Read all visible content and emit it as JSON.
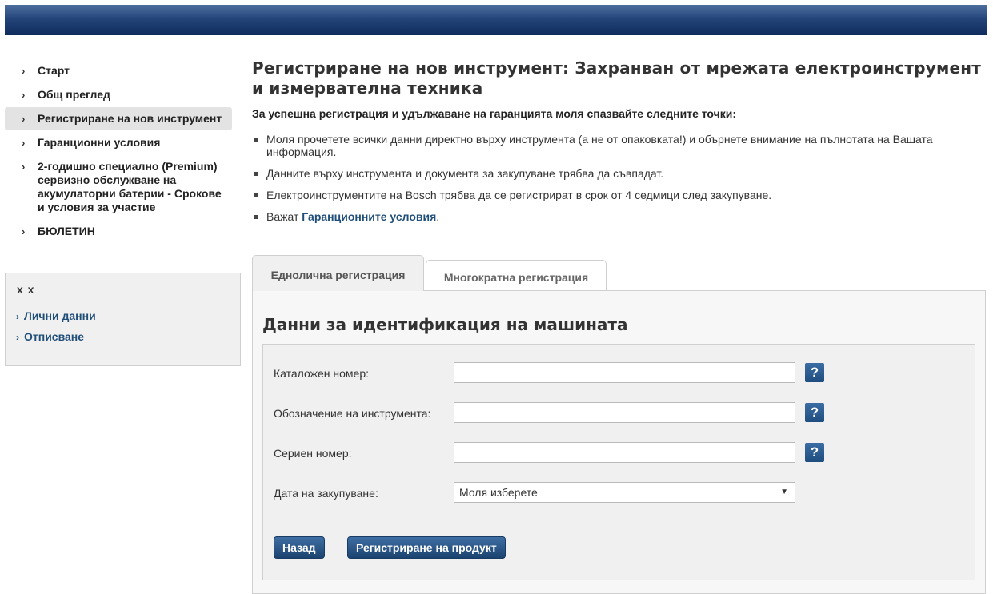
{
  "sidebar": {
    "items": [
      {
        "label": "Старт"
      },
      {
        "label": "Общ преглед"
      },
      {
        "label": "Регистриране на нов инструмент",
        "active": true
      },
      {
        "label": "Гаранционни условия"
      },
      {
        "label": "2-годишно специално (Premium) сервизно обслужване на акумулаторни батерии - Срокове и условия за участие"
      },
      {
        "label": "БЮЛЕТИН"
      }
    ],
    "user": {
      "name": "x x",
      "links": [
        "Лични данни",
        "Отписване"
      ]
    }
  },
  "main": {
    "title": "Регистриране на нов инструмент: Захранван от мрежата електроинструмент и измервателна техника",
    "intro": "За успешна регистрация и удължаване на гаранцията моля спазвайте следните точки:",
    "bullets": [
      "Моля прочетете всички данни директно върху инструмента (а не от опаковката!) и обърнете внимание на пълнотата на Вашата информация.",
      "Данните върху инструмента и документа за закупуване трябва да съвпадат.",
      "Електроинструментите на Bosch трябва да се регистрират в срок от 4 седмици след закупуване."
    ],
    "last_bullet_prefix": "Важат ",
    "last_bullet_link": "Гаранционните условия",
    "last_bullet_suffix": "."
  },
  "tabs": {
    "single": "Еднолична регистрация",
    "multiple": "Многократна регистрация"
  },
  "form": {
    "title": "Данни за идентификация на машината",
    "catalog_label": "Каталожен номер:",
    "designation_label": "Обозначение на инструмента:",
    "serial_label": "Сериен номер:",
    "date_label": "Дата на закупуване:",
    "date_value": "Моля изберете",
    "help_glyph": "?",
    "back_label": "Назад",
    "register_label": "Регистриране на продукт"
  },
  "colors": {
    "accent": "#1f4e79",
    "header": "#1b3a6b"
  }
}
